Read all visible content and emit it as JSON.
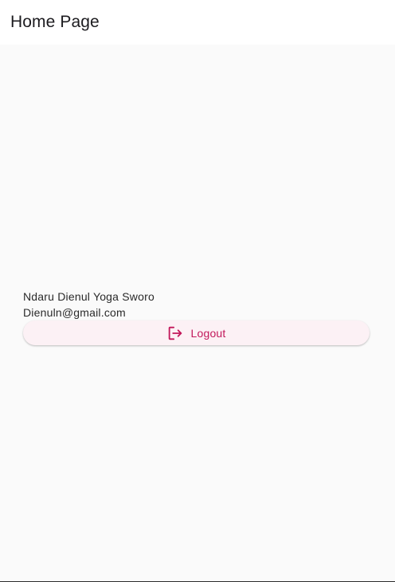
{
  "app_bar": {
    "title": "Home Page"
  },
  "profile": {
    "name": "Ndaru Dienul Yoga Sworo",
    "email": "Dienuln@gmail.com"
  },
  "logout": {
    "label": "Logout",
    "icon": "logout-icon"
  },
  "colors": {
    "accent": "#c2185b",
    "button_background": "#fcf1f5",
    "page_background": "#fafafa"
  }
}
